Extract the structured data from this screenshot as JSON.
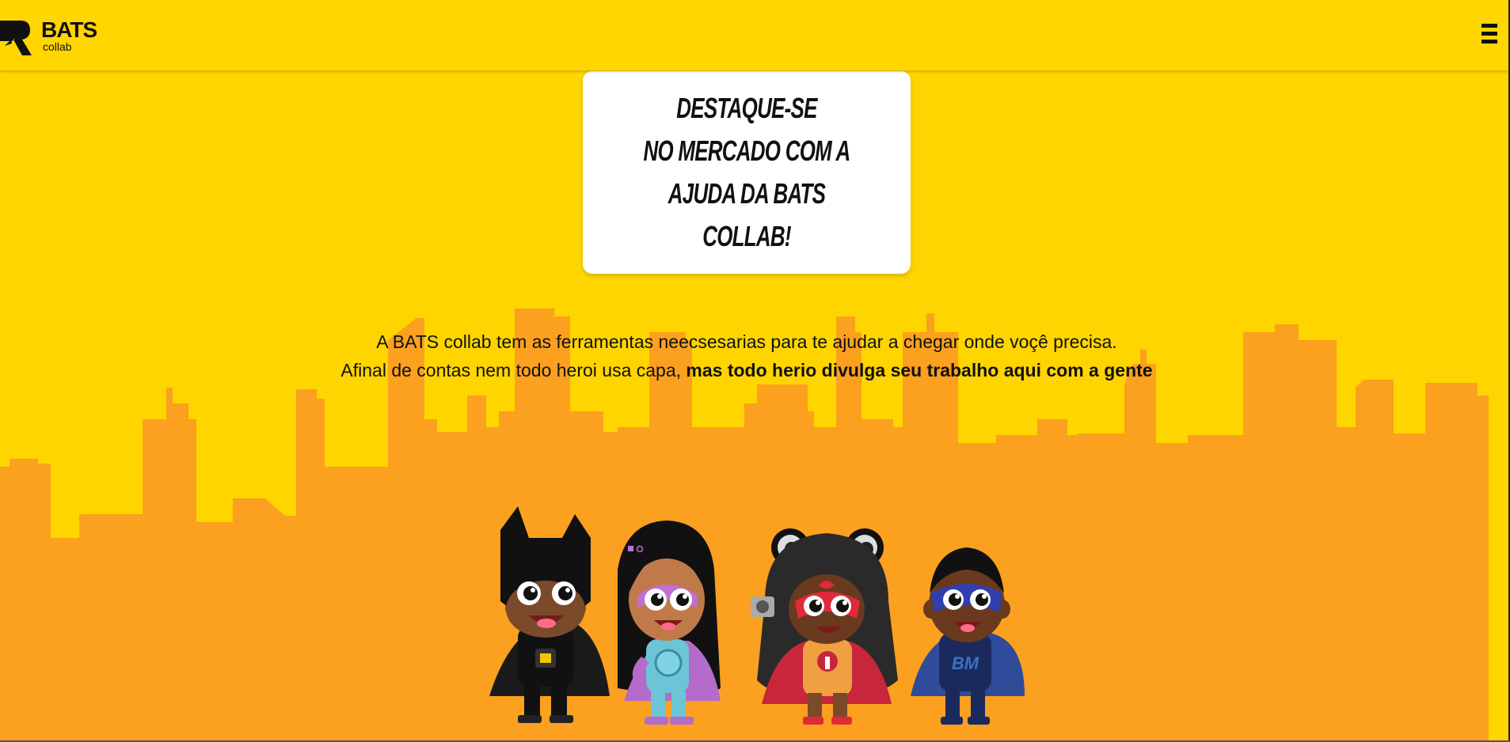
{
  "header": {
    "logo": {
      "name": "BATS",
      "sub": "collab"
    },
    "menu_icon": "hamburger-menu-icon"
  },
  "hero_card": {
    "lines": [
      "DESTAQUE-SE",
      "NO MERCADO COM A",
      "AJUDA DA BATS COLLAB!"
    ]
  },
  "intro": {
    "line1": "A BATS collab tem as ferramentas neecsesarias para te ajudar a chegar onde voçê precisa.",
    "line2_regular": "Afinal de contas nem todo heroi usa capa, ",
    "line2_bold": "mas todo herio divulga seu trabalho aqui com a gente"
  },
  "illustration": {
    "heroes": [
      "bat-hero",
      "social-hero",
      "info-hero",
      "code-hero"
    ],
    "badges": {
      "code_hero_chest": "BM"
    }
  },
  "colors": {
    "background": "#ffd500",
    "skyline": "#fba01f",
    "card": "#ffffff",
    "text": "#111111"
  }
}
